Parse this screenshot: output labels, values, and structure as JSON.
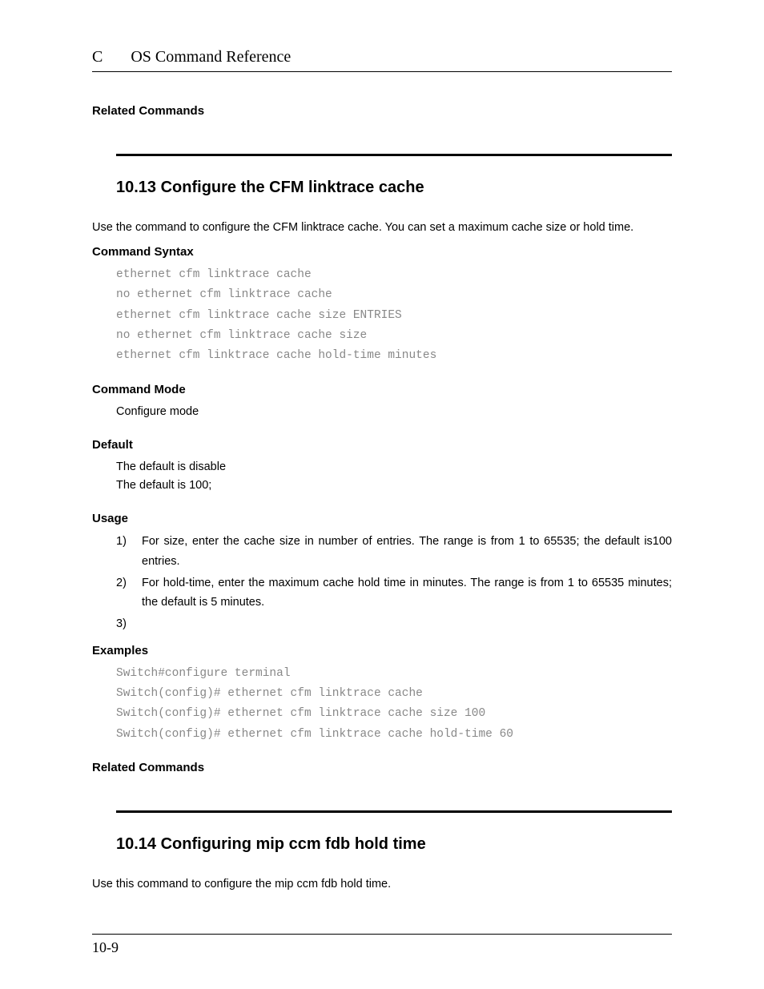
{
  "header": {
    "letter": "C",
    "title": "OS Command Reference"
  },
  "top_related": "Related Commands",
  "s13": {
    "title": "10.13  Configure the CFM linktrace cache",
    "intro": "Use the command to configure the CFM linktrace cache. You can set a maximum cache size or hold time.",
    "syntax_h": "Command Syntax",
    "syntax": "ethernet cfm linktrace cache\nno ethernet cfm linktrace cache\nethernet cfm linktrace cache size ENTRIES\nno ethernet cfm linktrace cache size\nethernet cfm linktrace cache hold-time minutes",
    "mode_h": "Command Mode",
    "mode": "Configure mode",
    "default_h": "Default",
    "default1": "The default is disable",
    "default2": "The default is 100;",
    "usage_h": "Usage",
    "usage": [
      {
        "n": "1)",
        "t": "For size, enter the cache size in number of entries. The range is from 1 to 65535; the default is100 entries."
      },
      {
        "n": "2)",
        "t": "For hold-time, enter the maximum cache hold time in minutes. The range is from 1 to 65535 minutes; the default is 5 minutes."
      },
      {
        "n": "3)",
        "t": ""
      }
    ],
    "examples_h": "Examples",
    "examples": "Switch#configure terminal\nSwitch(config)# ethernet cfm linktrace cache\nSwitch(config)# ethernet cfm linktrace cache size 100\nSwitch(config)# ethernet cfm linktrace cache hold-time 60",
    "related_h": "Related Commands"
  },
  "s14": {
    "title": "10.14  Configuring mip ccm fdb hold time",
    "intro": "Use this command to configure the mip ccm fdb hold time."
  },
  "footer": {
    "page": "10-9"
  }
}
